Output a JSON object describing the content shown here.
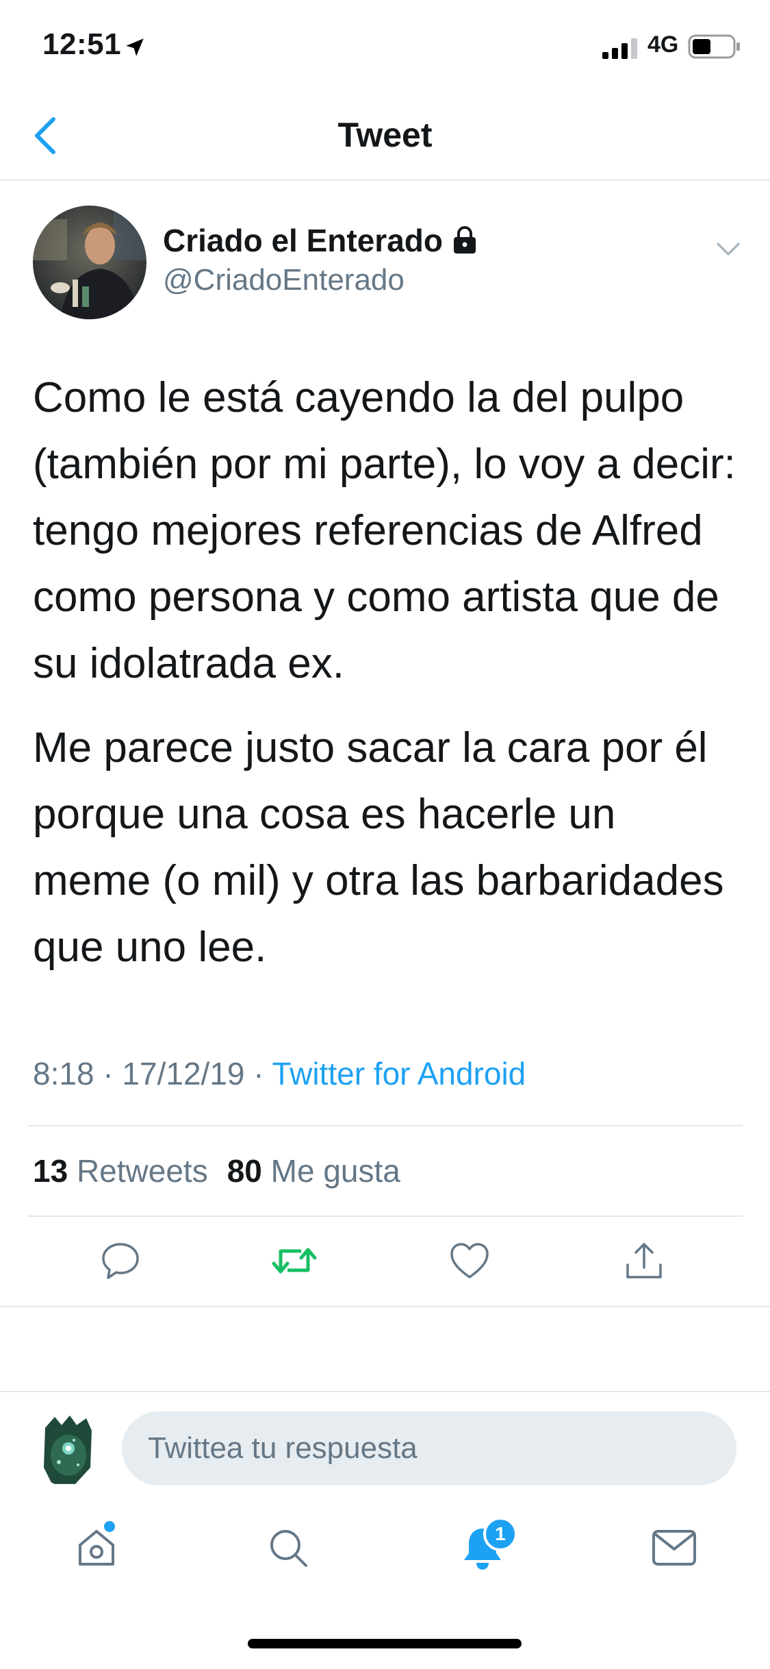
{
  "status_bar": {
    "time": "12:51",
    "network": "4G"
  },
  "header": {
    "title": "Tweet"
  },
  "tweet": {
    "author_name": "Criado el Enterado",
    "author_handle": "@CriadoEnterado",
    "body": [
      "Como le está cayendo la del pulpo (también por mi parte), lo voy a decir: tengo mejores referencias de Alfred como persona y como artista que de su idolatrada ex.",
      "Me parece justo sacar la cara por él porque una cosa es hacerle un meme (o mil) y otra las barbaridades que uno lee."
    ],
    "time": "8:18",
    "date": "17/12/19",
    "separator": "·",
    "source": "Twitter for Android",
    "retweets_count": "13",
    "retweets_label": "Retweets",
    "likes_count": "80",
    "likes_label": "Me gusta"
  },
  "actions": {
    "reply_icon": "reply-icon",
    "retweet_icon": "retweet-icon",
    "like_icon": "heart-icon",
    "share_icon": "share-icon"
  },
  "reply": {
    "placeholder": "Twittea tu respuesta"
  },
  "tab_bar": {
    "items": [
      "home-icon",
      "search-icon",
      "bell-icon",
      "mail-icon"
    ],
    "notifications_badge": "1"
  },
  "colors": {
    "accent": "#1da1f2",
    "retweet_green": "#17bf63",
    "secondary_text": "#657786",
    "divider": "#e1e8ed"
  }
}
